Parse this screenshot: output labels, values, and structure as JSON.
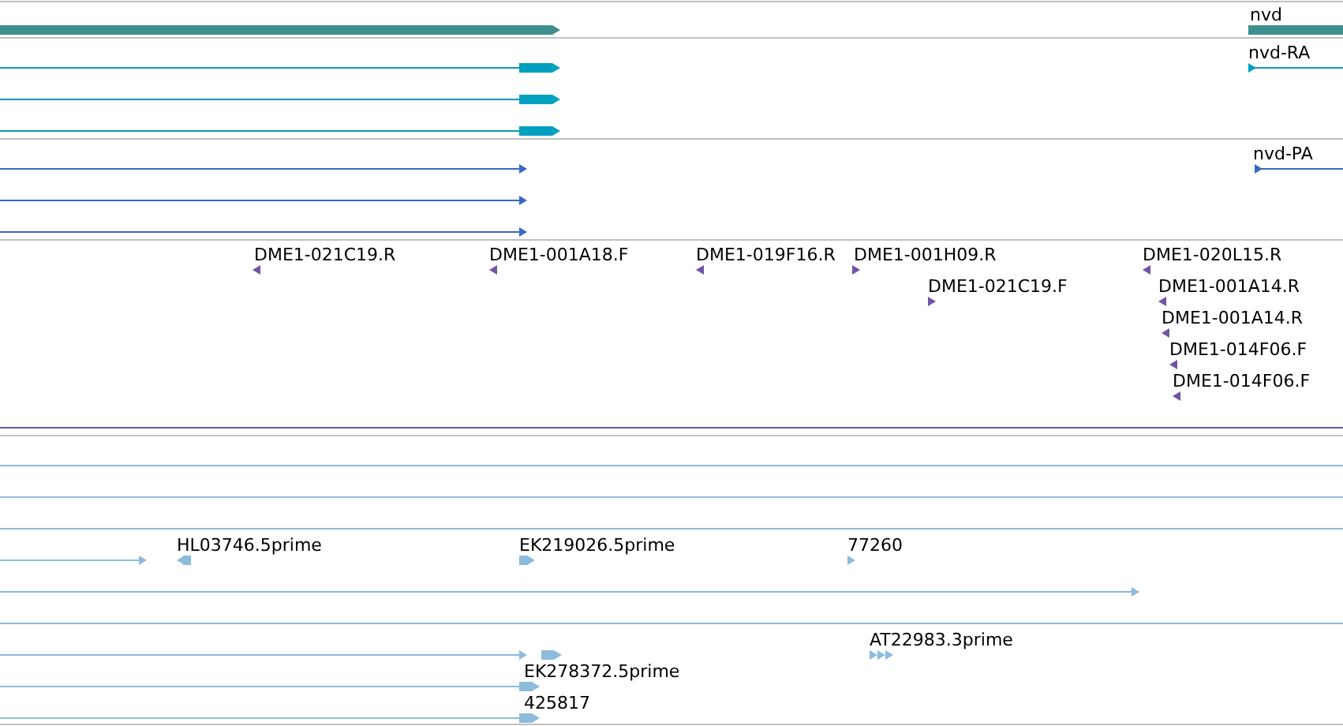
{
  "tracks": [
    {
      "kind": "gene",
      "labels": [
        "nvd"
      ]
    },
    {
      "kind": "transcript",
      "labels": [
        "nvd-RA"
      ]
    },
    {
      "kind": "protein",
      "labels": [
        "nvd-PA"
      ]
    },
    {
      "kind": "clone_end",
      "labels": [
        "DME1-021C19.R",
        "DME1-001A18.F",
        "DME1-019F16.R",
        "DME1-001H09.R",
        "DME1-021C19.F",
        "DME1-020L15.R",
        "DME1-001A14.R",
        "DME1-001A14.R",
        "DME1-014F06.F",
        "DME1-014F06.F"
      ]
    },
    {
      "kind": "est",
      "labels": [
        "HL03746.5prime",
        "EK219026.5prime",
        "77260",
        "AT22983.3prime",
        "EK278372.5prime",
        "425817"
      ]
    }
  ]
}
